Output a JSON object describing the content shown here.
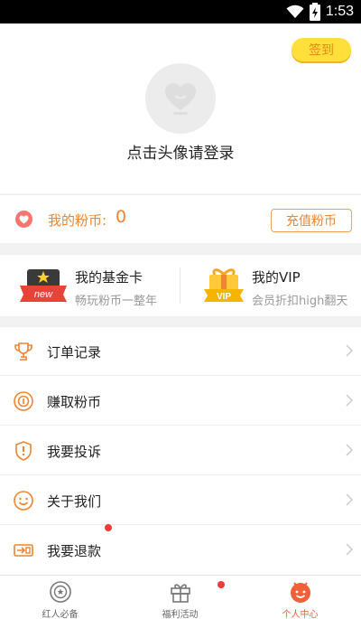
{
  "status_bar": {
    "time": "1:53"
  },
  "profile": {
    "checkin_label": "签到",
    "login_prompt": "点击头像请登录"
  },
  "coins": {
    "label": "我的粉币:",
    "value": "0",
    "recharge_label": "充值粉币"
  },
  "cards": [
    {
      "title": "我的基金卡",
      "subtitle": "畅玩粉币一整年",
      "badge": "new"
    },
    {
      "title": "我的VIP",
      "subtitle": "会员折扣high翻天",
      "badge": "VIP"
    }
  ],
  "menu": [
    {
      "label": "订单记录",
      "icon": "trophy-icon"
    },
    {
      "label": "赚取粉币",
      "icon": "coin-icon"
    },
    {
      "label": "我要投诉",
      "icon": "shield-icon"
    },
    {
      "label": "关于我们",
      "icon": "smile-icon"
    },
    {
      "label": "我要退款",
      "icon": "refund-icon"
    }
  ],
  "tabs": [
    {
      "label": "红人必备",
      "icon": "badge-icon"
    },
    {
      "label": "福利活动",
      "icon": "gift-icon"
    },
    {
      "label": "个人中心",
      "icon": "person-icon"
    }
  ],
  "colors": {
    "accent": "#f08431",
    "checkin_bg": "#ffe03a",
    "active_tab": "#f2603a",
    "dot": "#f03b3b"
  }
}
